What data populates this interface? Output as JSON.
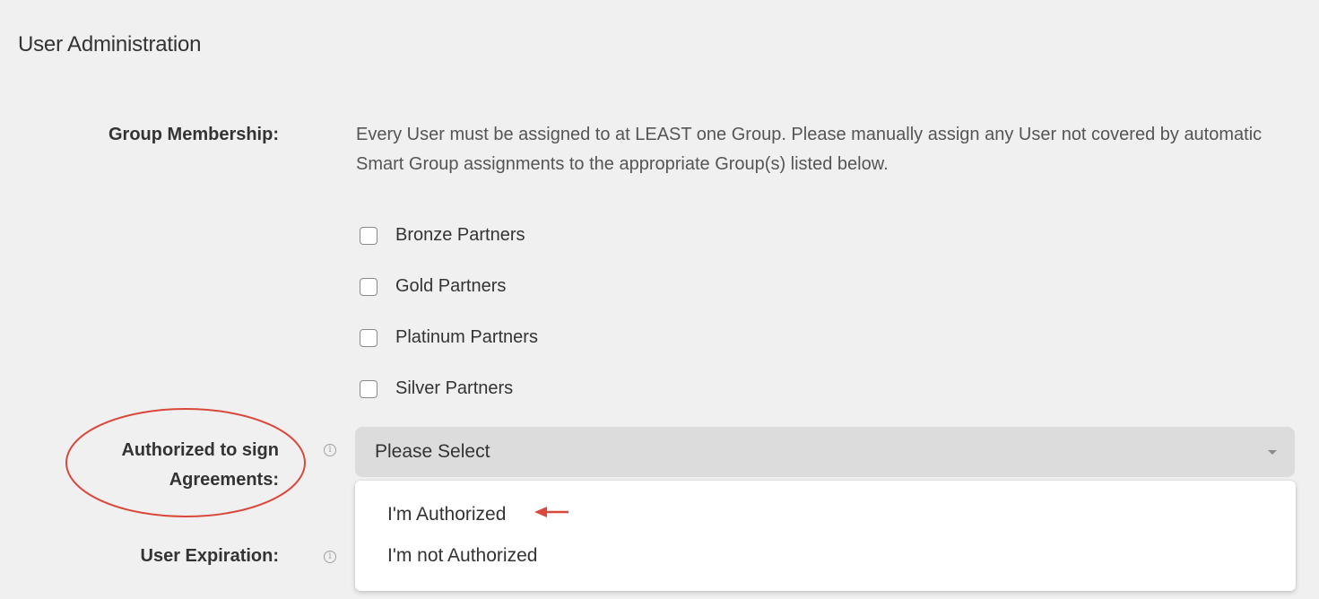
{
  "section": {
    "title": "User Administration"
  },
  "group_membership": {
    "label": "Group Membership:",
    "description": "Every User must be assigned to at LEAST one Group. Please manually assign any User not covered by automatic Smart Group assignments to the appropriate Group(s) listed below.",
    "groups": [
      {
        "label": "Bronze Partners",
        "checked": false
      },
      {
        "label": "Gold Partners",
        "checked": false
      },
      {
        "label": "Platinum Partners",
        "checked": false
      },
      {
        "label": "Silver Partners",
        "checked": false
      }
    ]
  },
  "authorized": {
    "label_line1": "Authorized to sign",
    "label_line2": "Agreements:",
    "select_value": "Please Select",
    "options": [
      "I'm Authorized",
      "I'm not Authorized"
    ]
  },
  "user_expiration": {
    "label": "User Expiration:"
  },
  "annotation": {
    "color": "#d9493b"
  }
}
